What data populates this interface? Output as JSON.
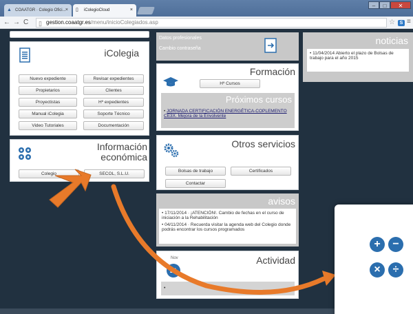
{
  "browser": {
    "tab1_label": "COAATGR · Colegio Ofici...",
    "tab2_label": "iColegioCloud",
    "tab_close": "×",
    "win_min": "–",
    "win_max": "□",
    "win_close": "✕",
    "url_host": "gestion.coaatgr.es",
    "url_path": "/menu/inicioColegiados.asp",
    "back": "←",
    "forward": "→",
    "reload": "C",
    "star": "☆",
    "ext": "S",
    "menu": "≡"
  },
  "icolegia": {
    "title": "iColegia",
    "buttons": [
      "Nuevo expediente",
      "Revisar expedientes",
      "Propietarios",
      "Clientes",
      "Proyectistas",
      "Hº expedientes",
      "Manual iColegia",
      "Soporte Técnico",
      "Video Tutoriales",
      "Documentación"
    ]
  },
  "info_economica": {
    "title_line1": "Información",
    "title_line2": "económica",
    "buttons": [
      "Colegio",
      "SECOL, S.L.U."
    ]
  },
  "datos": {
    "link1": "Datos profesionales",
    "link2": "Cambio contraseña"
  },
  "formacion": {
    "title": "Formación",
    "button": "Hº Cursos",
    "proximos_title": "Próximos cursos",
    "proximos_item": "JORNADA CERTIFICACIÓN ENERGÉTICA-COPLEMENTO CE3X. Mejora de la Envolvente"
  },
  "otros": {
    "title": "Otros servicios",
    "buttons": [
      "Bolsas de trabajo",
      "Certificados",
      "Contactar"
    ]
  },
  "avisos": {
    "title": "avisos",
    "items": [
      "17/11/2014 · ¡ATENCIÓN!. Cambio de fechas en el curso de iniciación a la Rehabilitación",
      "04/11/2014 · Recuerda visitar la agenda web del Colegio donde podrás encontrar los cursos programados"
    ]
  },
  "actividad": {
    "title": "Actividad",
    "month": "Nov",
    "day": "21",
    "bullet": "•"
  },
  "noticias": {
    "title": "noticias",
    "item": "11/04/2014 Abierto el plazo de Bolsas de trabajo para el año 2015"
  },
  "overlay": {
    "plus": "+",
    "minus": "−",
    "times": "×",
    "divide": "÷"
  },
  "colors": {
    "page_bg": "#213140",
    "accent_blue": "#2b6eae",
    "panel_gray": "#c8c8c8",
    "arrow_orange": "#e87a2a"
  }
}
